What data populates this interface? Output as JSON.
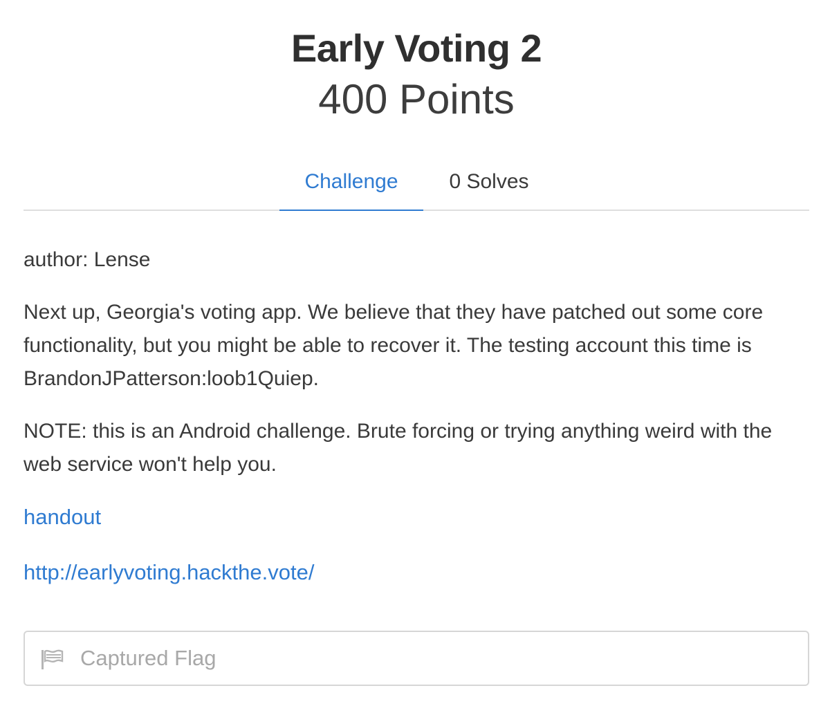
{
  "challenge": {
    "name": "Early Voting 2",
    "points": "400 Points"
  },
  "tabs": [
    {
      "label": "Challenge",
      "active": true
    },
    {
      "label": "0 Solves",
      "active": false
    }
  ],
  "description": {
    "author": "author: Lense",
    "paragraph1": "Next up, Georgia's voting app. We believe that they have patched out some core functionality, but you might be able to recover it. The testing account this time is BrandonJPatterson:loob1Quiep.",
    "note": "NOTE: this is an Android challenge. Brute forcing or trying anything weird with the web service won't help you.",
    "handout_link": "handout",
    "site_link": "http://earlyvoting.hackthe.vote/"
  },
  "flag_input": {
    "placeholder": "Captured Flag",
    "value": "",
    "icon": "flag-icon"
  },
  "colors": {
    "accent": "#2f7bd1",
    "text": "#3a3a3a",
    "border": "#d6d6d6"
  }
}
